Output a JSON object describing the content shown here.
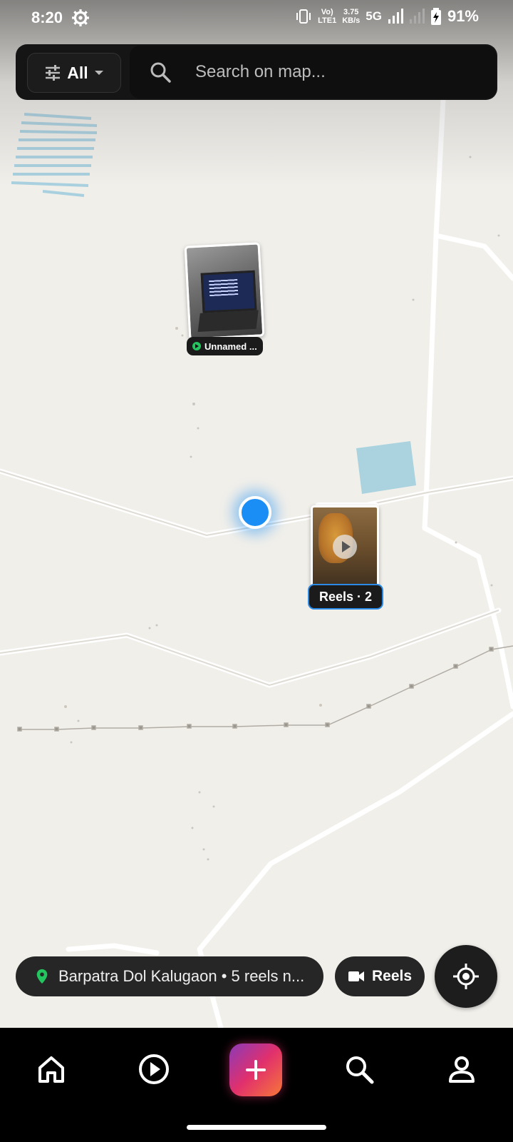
{
  "status_bar": {
    "time": "8:20",
    "network_speed": "3.75\nKB/s",
    "volte": "Vo)\nLTE1",
    "network_type": "5G",
    "battery": "91%"
  },
  "search": {
    "filter_label": "All",
    "placeholder": "Search on map..."
  },
  "map": {
    "markers": [
      {
        "label": "Unnamed ...",
        "type": "single"
      },
      {
        "label": "Reels · 2",
        "type": "cluster",
        "count": 2
      }
    ],
    "user_location_color": "#1a8ef5",
    "water_color": "#aad3df"
  },
  "bottom_bar": {
    "location_text": "Barpatra Dol Kalugaon • 5 reels n...",
    "reels_button": "Reels",
    "pin_color": "#22c55e"
  },
  "nav": {
    "items": [
      "home-icon",
      "reels-play-icon",
      "create-plus-icon",
      "search-icon",
      "profile-icon"
    ],
    "create_gradient": [
      "#8a3ab9",
      "#e1306c",
      "#f77737"
    ]
  }
}
